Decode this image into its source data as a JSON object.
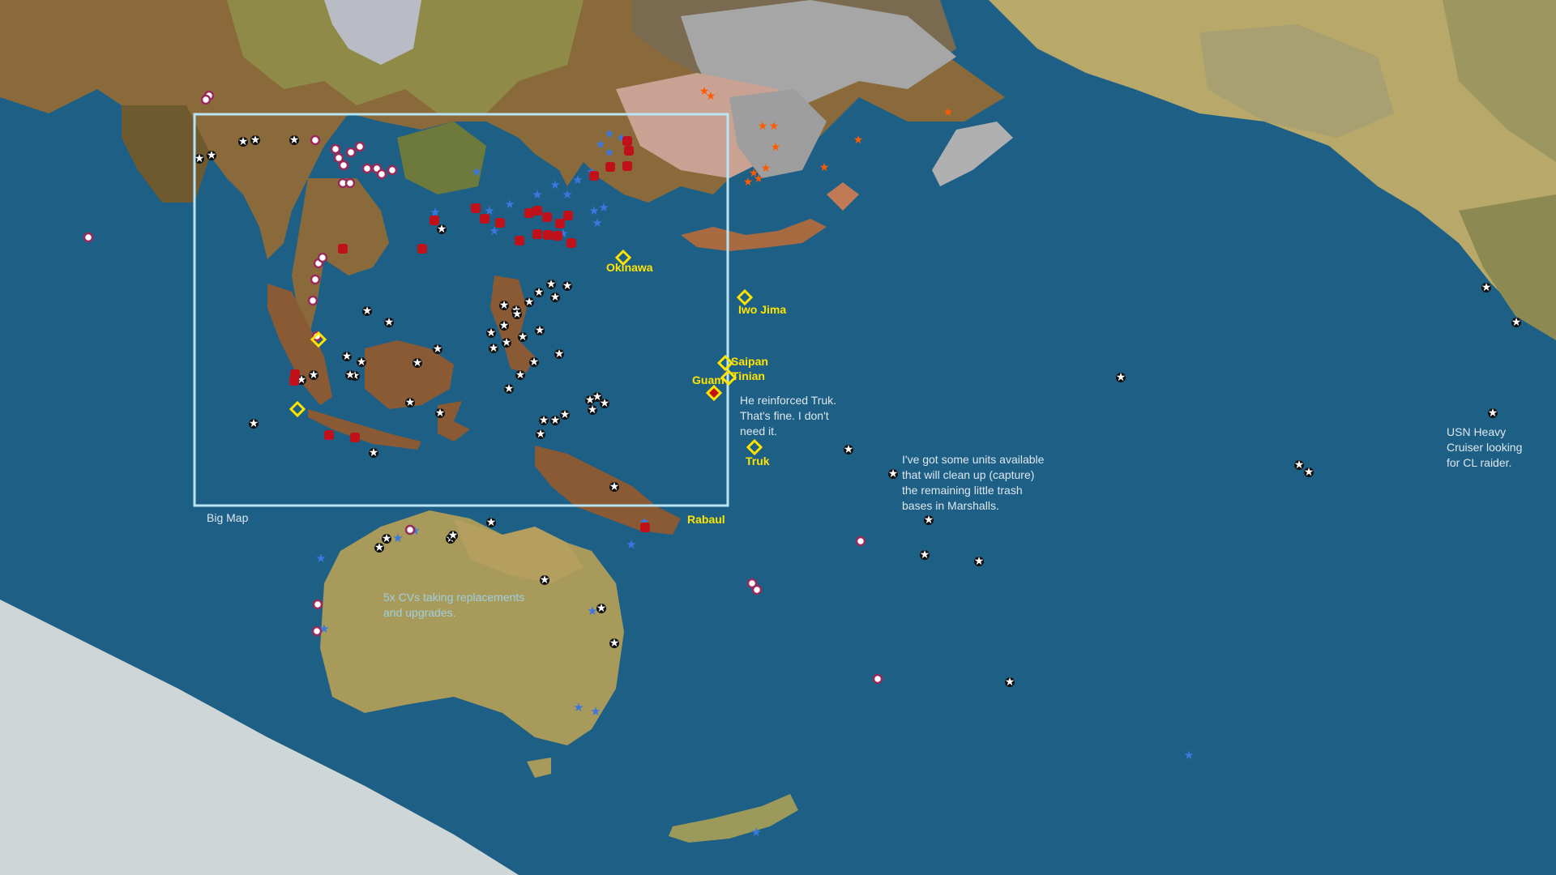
{
  "map": {
    "box_label": "Big Map",
    "locations": {
      "okinawa": "Okinawa",
      "iwo_jima": "Iwo Jima",
      "saipan": "Saipan",
      "tinian": "Tinian",
      "guam": "Guam",
      "truk": "Truk",
      "rabaul": "Rabaul"
    },
    "notes": {
      "truk": [
        "He reinforced Truk.",
        "That's fine.  I don't",
        "need it."
      ],
      "marshalls": [
        "I've got some units available",
        "that will clean up (capture)",
        "the remaining little trash",
        "bases in Marshalls."
      ],
      "usn": [
        "USN Heavy",
        "Cruiser looking",
        "for CL raider."
      ],
      "cvs": [
        "5x CVs taking replacements",
        "and upgrades."
      ]
    }
  },
  "colors": {
    "ocean": "#1e5f86",
    "objective": "#ffe400",
    "box": "#b8e4f4",
    "note_text": "#dde7ee",
    "axis_unit": "#c0111a",
    "allied_unit": "#3a78e0"
  }
}
